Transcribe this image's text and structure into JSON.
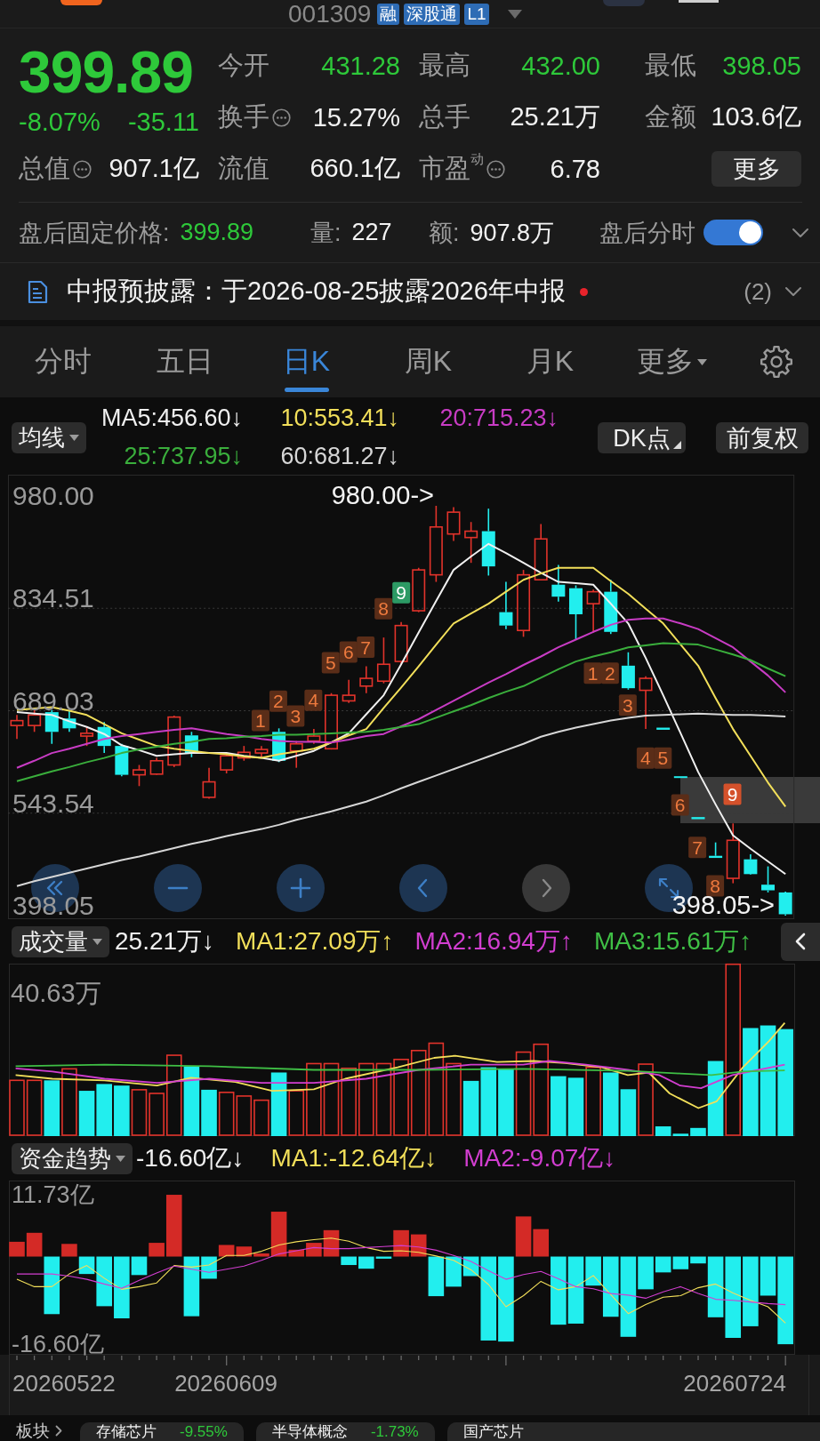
{
  "header": {
    "code": "001309",
    "badges": [
      "融",
      "深股通",
      "L1"
    ]
  },
  "quote": {
    "price": "399.89",
    "change_pct": "-8.07%",
    "change": "-35.11",
    "down": true,
    "stats": [
      {
        "label": "今开",
        "value": "431.28",
        "down": true,
        "info": false
      },
      {
        "label": "最高",
        "value": "432.00",
        "down": true,
        "info": false
      },
      {
        "label": "最低",
        "value": "398.05",
        "down": true,
        "info": false
      },
      {
        "label": "换手",
        "value": "15.27%",
        "down": false,
        "info": true
      },
      {
        "label": "总手",
        "value": "25.21万",
        "down": false,
        "info": false
      },
      {
        "label": "金额",
        "value": "103.6亿",
        "down": false,
        "info": false
      },
      {
        "label": "总值",
        "value": "907.1亿",
        "down": false,
        "info": true
      },
      {
        "label": "流值",
        "value": "660.1亿",
        "down": false,
        "info": false
      },
      {
        "label": "市盈$^{动}$",
        "value": "6.78",
        "down": false,
        "info": true
      }
    ],
    "more_button": "更多"
  },
  "after_hours": {
    "items": [
      {
        "label": "盘后固定价格:",
        "value": "399.89",
        "down": true
      },
      {
        "label": "量:",
        "value": "227",
        "down": false
      },
      {
        "label": "额:",
        "value": "907.8万",
        "down": false
      }
    ],
    "toggle": {
      "label": "盘后分时",
      "on": true
    }
  },
  "notice": {
    "text": "中报预披露：于2026-08-25披露2026年中报",
    "unread": true,
    "count": "(2)"
  },
  "tabs": [
    {
      "label": "分时",
      "selected": false,
      "dropdown": false
    },
    {
      "label": "五日",
      "selected": false,
      "dropdown": false
    },
    {
      "label": "日K",
      "selected": true,
      "dropdown": false
    },
    {
      "label": "周K",
      "selected": false,
      "dropdown": false
    },
    {
      "label": "月K",
      "selected": false,
      "dropdown": false
    },
    {
      "label": "更多",
      "selected": false,
      "dropdown": true
    }
  ],
  "indicators": {
    "selector": "均线",
    "items": [
      {
        "text": "MA5:456.60↓",
        "color": "#f0f0f0"
      },
      {
        "text": "10:553.41↓",
        "color": "#f2df5a"
      },
      {
        "text": "20:715.23↓",
        "color": "#c83cc4"
      },
      {
        "text": "25:737.95↓",
        "color": "#3aae3c"
      },
      {
        "text": "60:681.27↓",
        "color": "#d6d6d6"
      }
    ],
    "buttons": [
      "DK点",
      "前复权"
    ]
  },
  "price_chart": {
    "chart_data": {
      "type": "candlestick",
      "categories": [
        null,
        null,
        null,
        null,
        null,
        null,
        null,
        null,
        null,
        null,
        null,
        null,
        null,
        null,
        null,
        null,
        null,
        null,
        null,
        null,
        null,
        null,
        null,
        null,
        null,
        null,
        null,
        null,
        null,
        null,
        null,
        null,
        null,
        null,
        null,
        null,
        null,
        null,
        null,
        null,
        null,
        null,
        null,
        null,
        null
      ],
      "ylim": [
        393,
        1024.2
      ],
      "yticks": [
        {
          "value": 398.05,
          "label": "398.05"
        },
        {
          "value": 543.54,
          "label": "543.54"
        },
        {
          "value": 689.03,
          "label": "689.03"
        },
        {
          "value": 834.51,
          "label": "834.51"
        },
        {
          "value": 980,
          "label": "980.00"
        }
      ],
      "grid": true,
      "ohlc": [
        [
          668,
          683,
          649,
          675
        ],
        [
          668,
          690,
          659,
          683
        ],
        [
          687,
          690,
          642,
          659
        ],
        [
          678,
          690,
          659,
          664
        ],
        [
          653,
          666,
          639,
          657
        ],
        [
          666,
          673,
          629,
          639
        ],
        [
          639,
          642,
          596,
          598
        ],
        [
          598,
          612,
          582,
          605
        ],
        [
          599,
          622,
          598,
          618
        ],
        [
          612,
          682,
          609,
          680
        ],
        [
          654,
          659,
          623,
          629
        ],
        [
          566,
          608,
          564,
          588
        ],
        [
          605,
          629,
          600,
          625
        ],
        [
          622,
          639,
          618,
          630
        ],
        [
          629,
          639,
          622,
          634
        ],
        [
          659,
          664,
          616,
          618
        ],
        [
          632,
          646,
          608,
          642
        ],
        [
          646,
          663,
          642,
          653
        ],
        [
          635,
          714,
          634,
          711
        ],
        [
          703,
          733,
          700,
          711
        ],
        [
          724,
          752,
          714,
          735
        ],
        [
          731,
          793,
          728,
          755
        ],
        [
          759,
          815,
          755,
          810
        ],
        [
          831,
          892,
          829,
          889
        ],
        [
          882,
          980,
          872,
          950
        ],
        [
          940,
          978,
          930,
          971
        ],
        [
          935,
          957,
          899,
          944
        ],
        [
          944,
          976,
          881,
          894
        ],
        [
          829,
          872,
          805,
          810
        ],
        [
          803,
          889,
          794,
          882
        ],
        [
          875,
          954,
          874,
          933
        ],
        [
          868,
          896,
          844,
          851
        ],
        [
          863,
          867,
          790,
          826
        ],
        [
          841,
          861,
          800,
          858
        ],
        [
          858,
          875,
          798,
          801
        ],
        [
          753,
          772,
          719,
          721
        ],
        [
          718,
          738,
          663,
          735
        ],
        [
          665,
          665,
          662,
          662
        ],
        [
          596,
          596,
          594,
          594
        ],
        [
          538,
          538,
          535,
          535
        ],
        [
          483,
          502,
          480,
          480
        ],
        [
          451,
          529,
          444,
          505
        ],
        [
          478,
          485,
          456,
          457
        ],
        [
          442,
          468,
          431,
          434
        ],
        [
          431,
          432,
          398,
          400
        ]
      ],
      "series": [
        {
          "type": "line",
          "color": "#f0f0f0",
          "values": [
            687,
            685,
            683,
            674,
            666,
            656,
            640,
            633,
            625,
            627,
            629,
            629,
            629,
            625,
            622,
            618,
            625,
            632,
            644,
            657,
            684,
            711,
            755,
            800,
            845,
            889,
            908,
            926,
            913,
            899,
            885,
            872,
            870,
            868,
            841,
            813,
            764,
            711,
            657,
            602,
            556,
            512,
            493,
            475,
            457
          ]
        },
        {
          "type": "line",
          "color": "#f2df5a",
          "values": [
            690,
            692,
            694,
            689,
            683,
            670,
            657,
            648,
            639,
            635,
            632,
            629,
            627,
            624,
            622,
            627,
            631,
            635,
            644,
            654,
            663,
            693,
            722,
            752,
            783,
            813,
            827,
            841,
            858,
            875,
            884,
            892,
            892,
            892,
            873,
            855,
            834,
            813,
            783,
            753,
            707,
            663,
            625,
            587,
            553
          ]
        },
        {
          "type": "line",
          "color": "#c83cc4",
          "values": [
            608,
            618,
            629,
            635,
            642,
            649,
            653,
            656,
            659,
            662,
            664,
            660,
            656,
            653,
            649,
            646,
            645,
            645,
            644,
            648,
            653,
            656,
            667,
            677,
            690,
            703,
            716,
            729,
            741,
            754,
            766,
            779,
            790,
            801,
            811,
            818,
            820,
            820,
            813,
            805,
            792,
            779,
            759,
            739,
            715
          ]
        },
        {
          "type": "line",
          "color": "#3aae3c",
          "values": [
            589,
            596,
            603,
            609,
            616,
            622,
            629,
            634,
            638,
            642,
            645,
            649,
            650,
            652,
            653,
            655,
            655,
            656,
            657,
            658,
            659,
            662,
            666,
            670,
            679,
            688,
            697,
            707,
            716,
            724,
            736,
            748,
            759,
            766,
            772,
            779,
            782,
            785,
            784,
            783,
            776,
            769,
            761,
            749,
            738
          ]
        },
        {
          "type": "line",
          "color": "#d6d6d6",
          "values": [
            440,
            447,
            453,
            459,
            465,
            471,
            477,
            482,
            488,
            494,
            500,
            505,
            511,
            516,
            521,
            527,
            534,
            540,
            546,
            553,
            560,
            569,
            579,
            588,
            597,
            606,
            615,
            624,
            633,
            642,
            652,
            659,
            665,
            670,
            675,
            679,
            682,
            683,
            684,
            685,
            684,
            683,
            683,
            682,
            681
          ]
        }
      ]
    },
    "high_marker": "980.00->",
    "low_marker": "398.05->",
    "counts": [
      {
        "label": "1",
        "kind": "count"
      },
      {
        "label": "2",
        "kind": "count"
      },
      {
        "label": "3",
        "kind": "count"
      },
      {
        "label": "4",
        "kind": "count"
      },
      {
        "label": "5",
        "kind": "count"
      },
      {
        "label": "6",
        "kind": "count"
      },
      {
        "label": "7",
        "kind": "count"
      },
      {
        "label": "8",
        "kind": "count"
      },
      {
        "label": "9",
        "kind": "signal",
        "color": "#2c9a64"
      },
      {
        "label": "1",
        "kind": "count"
      },
      {
        "label": "2",
        "kind": "count"
      },
      {
        "label": "3",
        "kind": "count"
      },
      {
        "label": "4",
        "kind": "count"
      },
      {
        "label": "5",
        "kind": "count"
      },
      {
        "label": "6",
        "kind": "count"
      },
      {
        "label": "7",
        "kind": "count"
      },
      {
        "label": "8",
        "kind": "count"
      },
      {
        "label": "9",
        "kind": "signal",
        "color": "#d4512b"
      }
    ],
    "controls": [
      {
        "kind": "first",
        "disabled": false
      },
      {
        "kind": "zoom_out",
        "disabled": false
      },
      {
        "kind": "zoom_in",
        "disabled": false
      },
      {
        "kind": "prev",
        "disabled": false
      },
      {
        "kind": "next",
        "disabled": true
      },
      {
        "kind": "fullscreen",
        "disabled": false
      }
    ]
  },
  "volume": {
    "selector": "成交量",
    "items": [
      {
        "text": "25.21万↓",
        "color": "#f0f0f0"
      },
      {
        "text": "MA1:27.09万↑",
        "color": "#f2df5a"
      },
      {
        "text": "MA2:16.94万↑",
        "color": "#d23ed0"
      },
      {
        "text": "MA3:15.61万↑",
        "color": "#3fbf45"
      }
    ],
    "y_label": "40.63万"
  },
  "fund_flow": {
    "selector": "资金趋势",
    "items": [
      {
        "text": "-16.60亿↓",
        "color": "#f0f0f0"
      },
      {
        "text": "MA1:-12.64亿↓",
        "color": "#f2df5a"
      },
      {
        "text": "MA2:-9.07亿↓",
        "color": "#d23ed0"
      }
    ],
    "chart_data": {
      "type": "bar",
      "stacked": true,
      "ylim": [
        -18.6,
        14.4
      ],
      "yticks": [
        {
          "value": -16.6,
          "label": "-16.60亿"
        },
        {
          "value": 11.73,
          "label": "11.73亿"
        }
      ],
      "series": [
        {
          "color": "#d42a26",
          "values": [
            2.8,
            4.5,
            null,
            2.4,
            null,
            null,
            null,
            null,
            2.6,
            11.7,
            null,
            null,
            2.2,
            1.9,
            0.6,
            8.5,
            1.3,
            2.6,
            5,
            null,
            null,
            null,
            5,
            4.2,
            null,
            null,
            null,
            null,
            null,
            7.6,
            5.2,
            null,
            null,
            null,
            null,
            null,
            null,
            null,
            null,
            null,
            null,
            null,
            null,
            null,
            null
          ]
        },
        {
          "color": "#22eeee",
          "values": [
            null,
            null,
            -10.9,
            null,
            -3.3,
            -9.4,
            -11.7,
            -3.5,
            null,
            null,
            -11.3,
            -4.2,
            null,
            null,
            null,
            null,
            null,
            null,
            null,
            -1.6,
            -2.3,
            -0.4,
            null,
            null,
            -7.5,
            -5.7,
            -3.7,
            -15.9,
            -16.1,
            null,
            null,
            -12.9,
            -12.7,
            -5.5,
            -11.4,
            -15.2,
            -6.2,
            -3,
            -2.4,
            -1.3,
            -11.5,
            -15.4,
            -13.2,
            -7.4,
            -16.6
          ]
        },
        {
          "type": "line",
          "color": "#f2df5a",
          "values": [
            -4.3,
            -5.7,
            -5.7,
            -3.3,
            -1.7,
            -4.1,
            -6.2,
            -5.7,
            -5,
            -1.7,
            -2,
            -1.6,
            0.2,
            0.2,
            1,
            2.2,
            2.8,
            3.2,
            3.5,
            2.9,
            1.7,
            1,
            1.1,
            0.8,
            0.1,
            -0.7,
            -2.5,
            -5.3,
            -9.5,
            -7.4,
            -4.7,
            -6.3,
            -5.7,
            -3.6,
            -7.2,
            -10.8,
            -9.1,
            -7.7,
            -7.4,
            -5.9,
            -5.2,
            -6.9,
            -8.3,
            -9.5,
            -12.6
          ]
        },
        {
          "type": "line",
          "color": "#d23ed0",
          "values": [
            -3.3,
            -3.3,
            -3.3,
            -3.7,
            -4.3,
            -5.2,
            -6,
            -4.5,
            -3.1,
            -1.8,
            -2.4,
            -3,
            -2.4,
            -1.8,
            -0.7,
            0.5,
            1.1,
            1.7,
            1.5,
            1.5,
            1.7,
            1.9,
            2.1,
            1.8,
            1.2,
            0.2,
            -0.9,
            -2.7,
            -4.3,
            -3.4,
            -2.8,
            -4.2,
            -5.7,
            -6.1,
            -7,
            -7.3,
            -7.9,
            -6.7,
            -5.7,
            -7,
            -8.1,
            -8.3,
            -8.6,
            -8.9,
            -9.1
          ]
        }
      ]
    }
  },
  "x_axis": [
    "20260522",
    "20260609",
    "20260724"
  ],
  "sectors": {
    "label": "板块",
    "items": [
      {
        "name": "存储芯片",
        "change": "-9.55%"
      },
      {
        "name": "半导体概念",
        "change": "-1.73%"
      },
      {
        "name": "国产芯片"
      }
    ]
  }
}
